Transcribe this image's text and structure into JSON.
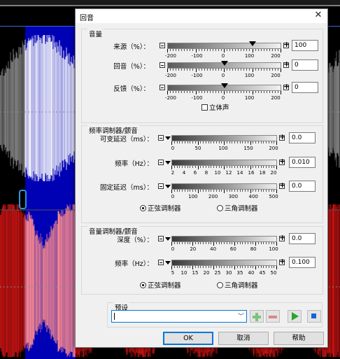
{
  "dialog": {
    "title": "回音",
    "close_glyph": "✕"
  },
  "volume": {
    "group_title": "音量",
    "rows": [
      {
        "label": "来源（%）：",
        "value": "100",
        "scale": [
          "-200",
          "-100",
          "0",
          "100",
          "200"
        ],
        "level_percent": 100
      },
      {
        "label": "回音（%）：",
        "value": "0",
        "scale": [
          "-200",
          "-100",
          "0",
          "100",
          "200"
        ],
        "level_percent": 0
      },
      {
        "label": "反馈（%）：",
        "value": "0",
        "scale": [
          "-200",
          "-100",
          "0",
          "100",
          "200"
        ],
        "level_percent": 0
      }
    ],
    "stereo_label": "立体声"
  },
  "fm": {
    "group_title": "频率调制器/颤音",
    "rows": [
      {
        "label": "可变延迟（ms）：",
        "value": "0.0",
        "scale": [
          "0",
          "50",
          "100",
          "150",
          "200"
        ]
      },
      {
        "label": "频率（Hz）：",
        "value": "0.010",
        "scale": [
          "2",
          "4",
          "6",
          "8",
          "10",
          "12",
          "14",
          "16",
          "18",
          "20"
        ]
      },
      {
        "label": "固定延迟（ms）：",
        "value": "0.0",
        "scale": [
          "0",
          "100",
          "200",
          "300",
          "400",
          "500"
        ]
      }
    ],
    "radio_sine": "正弦调制器",
    "radio_triangle": "三角调制器",
    "selected": "正弦调制器"
  },
  "am": {
    "group_title": "音量调制器/颤音",
    "rows": [
      {
        "label": "深度（%）：",
        "value": "0.0",
        "scale": [
          "0",
          "20",
          "40",
          "60",
          "80",
          "100"
        ]
      },
      {
        "label": "频率（Hz）：",
        "value": "0.100",
        "scale": [
          "5",
          "10",
          "15",
          "20",
          "25",
          "30",
          "35",
          "40",
          "45",
          "50"
        ]
      }
    ],
    "radio_sine": "正弦调制器",
    "radio_triangle": "三角调制器",
    "selected": "正弦调制器"
  },
  "preset": {
    "group_title": "预设",
    "combo_value": ""
  },
  "buttons": {
    "ok": "OK",
    "cancel": "取消",
    "help": "帮助"
  },
  "colors": {
    "selection_blue": "#0000b4",
    "channel_gray": "#8c8c8c",
    "channel_red": "#d21414",
    "accent": "#0078d7"
  }
}
